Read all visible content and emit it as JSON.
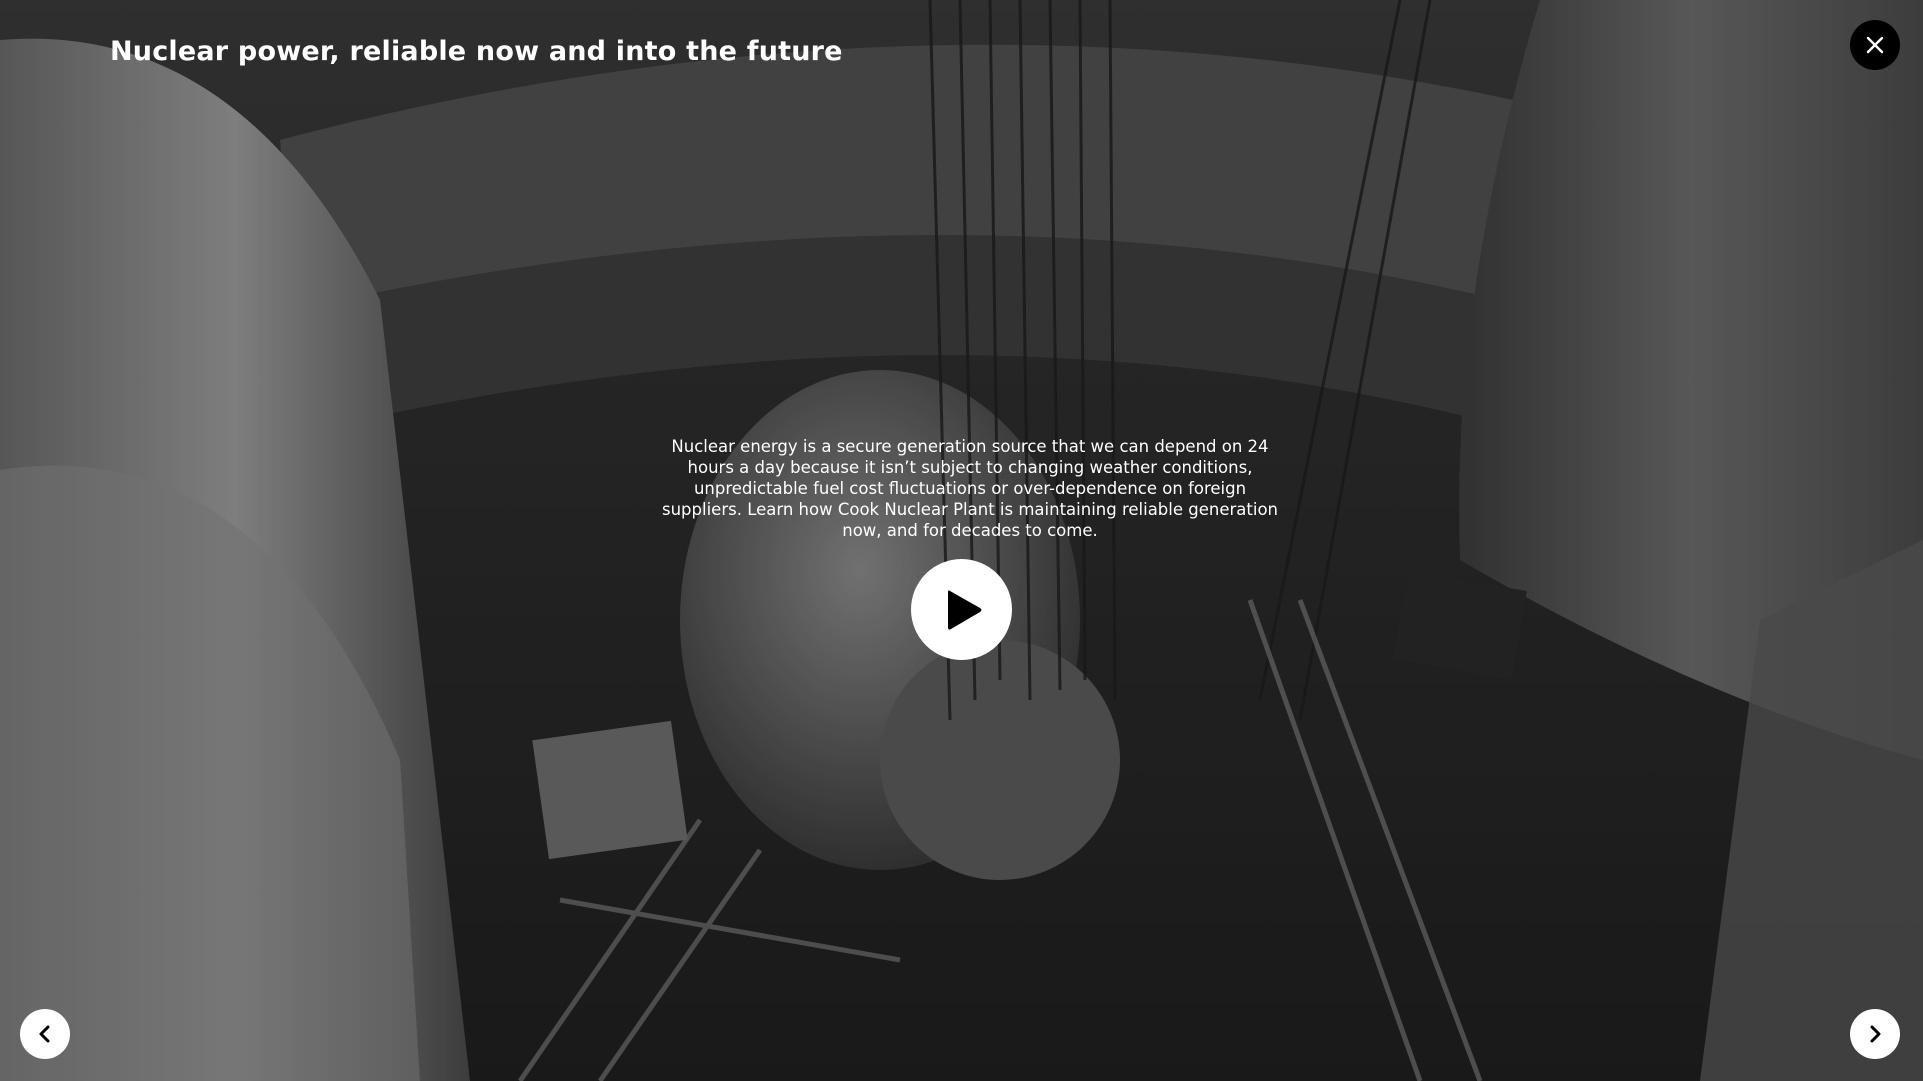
{
  "modal": {
    "title": "Nuclear power, reliable now and into the future",
    "description": "Nuclear energy is a secure generation source that we can depend on 24 hours a day because it isn’t subject to changing weather conditions, unpredictable fuel cost fluctuations or over-dependence on foreign suppliers. Learn how Cook Nuclear Plant is maintaining reliable generation now, and for decades to come."
  },
  "controls": {
    "close_icon": "close-icon",
    "play_icon": "play-icon",
    "prev_icon": "chevron-left-icon",
    "next_icon": "chevron-right-icon"
  },
  "colors": {
    "text": "#ffffff",
    "close_bg": "#000000",
    "nav_bg": "#ffffff",
    "overlay": "#000000"
  }
}
